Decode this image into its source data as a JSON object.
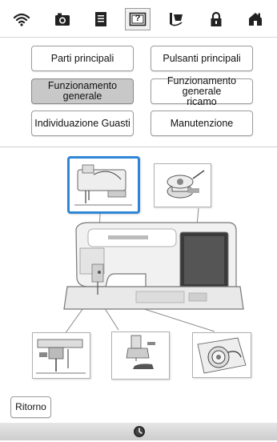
{
  "toolbar": {
    "icons": [
      "wifi-icon",
      "camera-icon",
      "document-icon",
      "help-icon",
      "threading-icon",
      "lock-icon",
      "home-icon"
    ],
    "selected": "help-icon",
    "help_glyph": "?"
  },
  "menu": {
    "parti_principali": "Parti principali",
    "pulsanti_principali": "Pulsanti principali",
    "funzionamento_generale": "Funzionamento generale",
    "funzionamento_ricamo_line1": "Funzionamento generale",
    "funzionamento_ricamo_line2": "ricamo",
    "individuazione_guasti": "Individuazione Guasti",
    "manutenzione": "Manutenzione",
    "selected_item": "Funzionamento generale"
  },
  "diagram": {
    "topics": [
      "threading-thumbnail",
      "bobbin-winding-thumbnail",
      "needle-threader-thumbnail",
      "presser-foot-thumbnail",
      "bobbin-case-thumbnail"
    ],
    "highlighted": "threading-thumbnail",
    "accent_color": "#2f86d6"
  },
  "footer": {
    "back_label": "Ritorno",
    "status_icon": "clock-icon"
  }
}
